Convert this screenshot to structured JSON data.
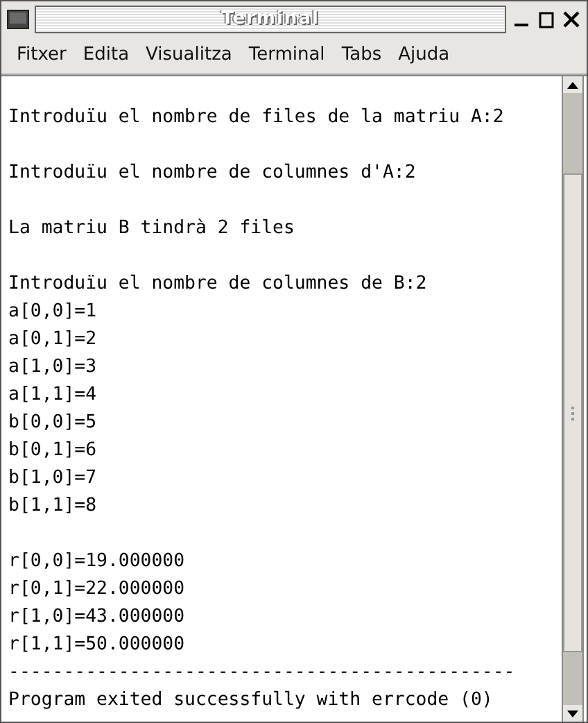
{
  "window": {
    "title": "Terminal"
  },
  "menu": [
    "Fitxer",
    "Edita",
    "Visualitza",
    "Terminal",
    "Tabs",
    "Ajuda"
  ],
  "terminal": {
    "blocks": [
      [
        "Introduïu el nombre de files de la matriu A:2"
      ],
      [
        "Introduïu el nombre de columnes d'A:2"
      ],
      [
        "La matriu B tindrà 2 files"
      ],
      [
        "Introduïu el nombre de columnes de B:2",
        "a[0,0]=1",
        "a[0,1]=2",
        "a[1,0]=3",
        "a[1,1]=4",
        "b[0,0]=5",
        "b[0,1]=6",
        "b[1,0]=7",
        "b[1,1]=8"
      ],
      [
        "r[0,0]=19.000000",
        "r[0,1]=22.000000",
        "r[1,0]=43.000000",
        "r[1,1]=50.000000",
        "----------------------------------------------",
        "Program exited successfully with errcode (0)"
      ]
    ]
  }
}
